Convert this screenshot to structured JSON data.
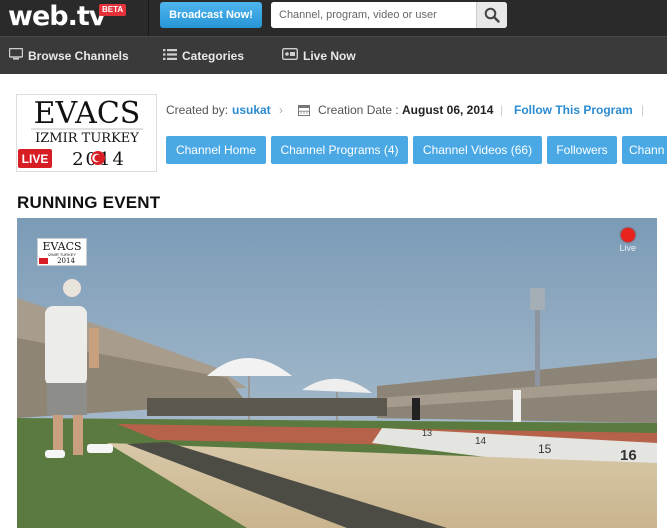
{
  "topbar": {
    "logo_text": "web.tv",
    "beta_label": "BETA",
    "broadcast_label": "Broadcast Now!",
    "search_placeholder": "Channel, program, video or user"
  },
  "nav": {
    "items": [
      {
        "label": "Browse Channels",
        "icon": "monitor-icon"
      },
      {
        "label": "Categories",
        "icon": "list-icon"
      },
      {
        "label": "Live Now",
        "icon": "live-camera-icon"
      }
    ]
  },
  "channel": {
    "logo_line1": "EVACS",
    "logo_line2": "IZMIR TURKEY",
    "logo_year": "2014",
    "logo_live": "LIVE",
    "created_by_label": "Created by:",
    "created_by_user": "usukat",
    "creation_date_label": "Creation Date :",
    "creation_date": "August 06, 2014",
    "follow_label": "Follow This Program"
  },
  "tabs": [
    {
      "label": "Channel Home"
    },
    {
      "label": "Channel Programs (4)"
    },
    {
      "label": "Channel Videos (66)"
    },
    {
      "label": "Followers"
    },
    {
      "label": "Chann"
    }
  ],
  "page_title": "RUNNING EVENT",
  "video": {
    "live_label": "Live",
    "lane_markers": [
      "13",
      "14",
      "15",
      "16"
    ],
    "logo_line1": "EVACS",
    "logo_line2": "IZMIR TURKEY",
    "logo_year": "2014"
  },
  "colors": {
    "topbar": "#2a2a2a",
    "navbar": "#3a3a3a",
    "accent_blue": "#4aa9e4",
    "link_blue": "#2a8bd0",
    "live_red": "#e8221c"
  }
}
